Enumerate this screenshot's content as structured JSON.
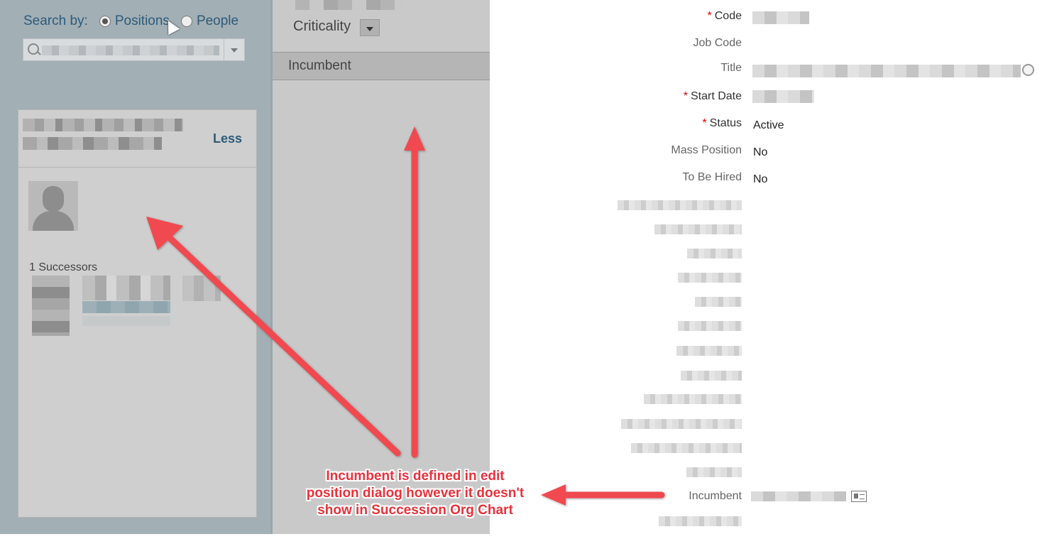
{
  "search": {
    "label": "Search by:",
    "options": [
      {
        "label": "Positions",
        "selected": true
      },
      {
        "label": "People",
        "selected": false
      }
    ]
  },
  "card": {
    "toggle_label": "Less",
    "successors_label": "1 Successors"
  },
  "middle": {
    "criticality_label": "Criticality",
    "incumbent_label": "Incumbent"
  },
  "form": {
    "required_marker": "*",
    "fields": {
      "code": "Code",
      "job_code": "Job Code",
      "title": "Title",
      "start_date": "Start Date",
      "status": "Status",
      "status_value": "Active",
      "mass_position": "Mass Position",
      "mass_position_value": "No",
      "to_be_hired": "To Be Hired",
      "to_be_hired_value": "No",
      "incumbent": "Incumbent"
    }
  },
  "annotation": {
    "text": "Incumbent is defined in edit position dialog however it doesn't show in Succession Org Chart",
    "color": "#e8323a"
  },
  "colors": {
    "left_panel_bg": "#a2afb5",
    "link": "#2d5b7a",
    "required": "#dd0000"
  }
}
